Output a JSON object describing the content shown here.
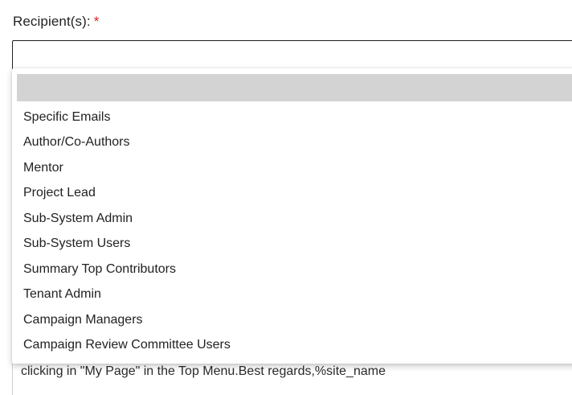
{
  "form": {
    "recipients_label": "Recipient(s):",
    "required_marker": "*"
  },
  "dropdown": {
    "options": [
      "",
      "Specific Emails",
      "Author/Co-Authors",
      "Mentor",
      "Project Lead",
      "Sub-System Admin",
      "Sub-System Users",
      "Summary Top Contributors",
      "Tenant Admin",
      "Campaign Managers",
      "Campaign Review Committee Users"
    ]
  },
  "editor": {
    "visible_text": "clicking in \"My Page\" in the Top Menu.Best regards,%site_name"
  }
}
